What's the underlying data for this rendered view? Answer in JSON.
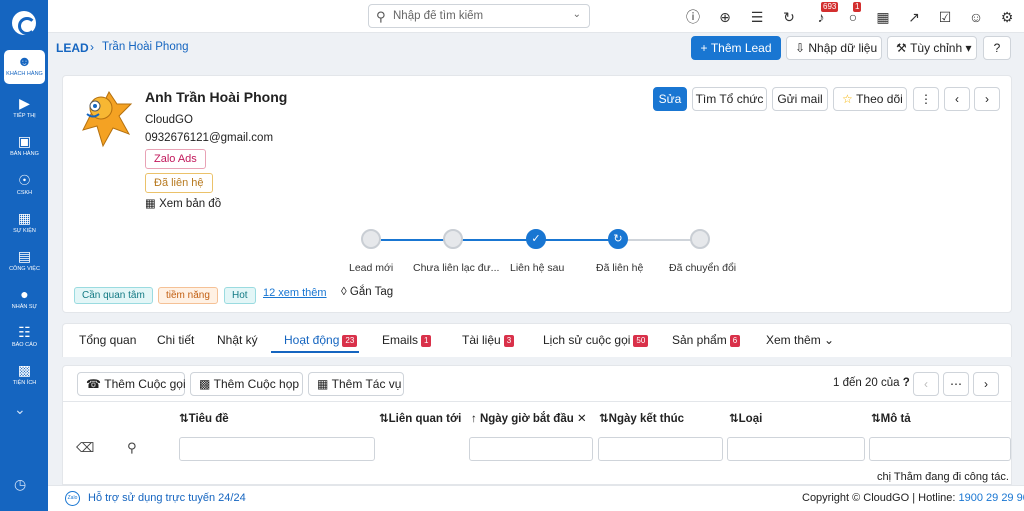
{
  "sidebar": {
    "items": [
      {
        "label": "Khách hàng",
        "icon": "users-icon",
        "active": true
      },
      {
        "label": "Tiếp thị",
        "icon": "megaphone-icon"
      },
      {
        "label": "Bán hàng",
        "icon": "cart-icon"
      },
      {
        "label": "CSKH",
        "icon": "lifebuoy-icon"
      },
      {
        "label": "Sự kiện",
        "icon": "calendar-icon"
      },
      {
        "label": "Công việc",
        "icon": "briefcase-icon"
      },
      {
        "label": "Nhân sự",
        "icon": "person-icon"
      },
      {
        "label": "Báo cáo",
        "icon": "chart-icon"
      },
      {
        "label": "Tiện ích",
        "icon": "apps-icon"
      }
    ]
  },
  "search": {
    "placeholder": "Nhập để tìm kiếm"
  },
  "topbar": {
    "notif_count": "693",
    "chat_count": "1"
  },
  "breadcrumb": {
    "root": "LEAD",
    "separator": "›",
    "current": "Trần Hoài Phong"
  },
  "header_actions": {
    "add_lead": "Thêm Lead",
    "import": "Nhập dữ liệu",
    "customize": "Tùy chỉnh"
  },
  "record": {
    "name": "Anh Trần Hoài Phong",
    "company": "CloudGO",
    "contact": "0932676121@gmail.com",
    "source_tag": "Zalo Ads",
    "status_tag": "Đã liên hệ",
    "map_link": "Xem bản đồ",
    "actions": {
      "edit": "Sửa",
      "find_org": "Tìm Tổ chức",
      "send_mail": "Gửi mail",
      "follow": "Theo dõi"
    }
  },
  "pipeline": {
    "steps": [
      "Lead mới",
      "Chưa liên lạc đư...",
      "Liên hệ sau",
      "Đã liên hệ",
      "Đã chuyển đổi"
    ]
  },
  "tags": {
    "items": [
      "Cần quan tâm",
      "tiềm năng",
      "Hot"
    ],
    "more": "12 xem thêm",
    "add": "Gắn Tag"
  },
  "tabs": [
    {
      "label": "Tổng quan"
    },
    {
      "label": "Chi tiết"
    },
    {
      "label": "Nhật ký"
    },
    {
      "label": "Hoạt động",
      "badge": "23",
      "active": true
    },
    {
      "label": "Emails",
      "badge": "1"
    },
    {
      "label": "Tài liệu",
      "badge": "3"
    },
    {
      "label": "Lịch sử cuộc gọi",
      "badge": "50"
    },
    {
      "label": "Sản phẩm",
      "badge": "6"
    },
    {
      "label": "Xem thêm"
    }
  ],
  "activity": {
    "add_call": "Thêm Cuộc gọi",
    "add_meeting": "Thêm Cuộc họp",
    "add_task": "Thêm Tác vụ",
    "pagination": "1 đến 20 của",
    "pagination_unknown": "?",
    "columns": [
      "Tiêu đề",
      "Liên quan tới",
      "Ngày giờ bắt đầu",
      "Ngày kết thúc",
      "Loại",
      "Mô tả"
    ],
    "row_preview": "chị Thắm đang đi công tác."
  },
  "footer": {
    "support": "Hỗ trợ sử dụng trực tuyến 24/24",
    "copyright": "Copyright © CloudGO",
    "hotline_label": "| Hotline:",
    "hotline": "1900 29 29 90"
  }
}
